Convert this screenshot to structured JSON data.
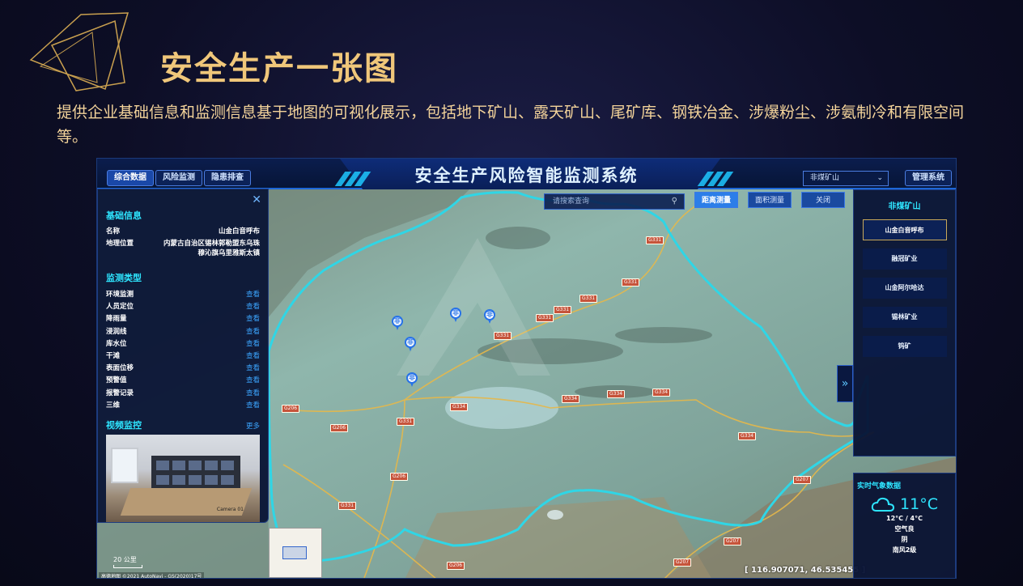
{
  "slide": {
    "title": "安全生产一张图",
    "description": "提供企业基础信息和监测信息基于地图的可视化展示，包括地下矿山、露天矿山、尾矿库、钢铁冶金、涉爆粉尘、涉氨制冷和有限空间等。"
  },
  "app": {
    "title": "安全生产风险智能监测系统",
    "nav": [
      "综合数据",
      "风险监测",
      "隐患排查"
    ],
    "select_value": "非煤矿山",
    "manage_label": "管理系统"
  },
  "map": {
    "search_placeholder": "请搜索查询",
    "tools": [
      "距离测量",
      "面积测量",
      "关闭"
    ],
    "marker_label": "非",
    "road_labels": [
      "G331",
      "G331",
      "G331",
      "G331",
      "G331",
      "G331",
      "G334",
      "G334",
      "G334",
      "G334",
      "G206",
      "G331",
      "G206",
      "G206",
      "G331",
      "G334",
      "G207",
      "G207",
      "G207",
      "G206",
      "G207",
      "G331"
    ],
    "coordinates": "[ 116.907071, 46.535455 ]",
    "scale_label": "20 公里",
    "copyright": "高德地图 ©2021 AutoNavi - GS(2020)17号"
  },
  "info": {
    "basic_title": "基础信息",
    "name_key": "名称",
    "name_value": "山金白音呼布",
    "location_key": "地理位置",
    "location_value": "内蒙古自治区锡林郭勒盟东乌珠穆沁旗乌里雅斯太镇",
    "monitor_title": "监测类型",
    "monitor_items": [
      "环境监测",
      "人员定位",
      "降雨量",
      "浸润线",
      "库水位",
      "干滩",
      "表面位移",
      "预警值",
      "报警记录",
      "三维"
    ],
    "view_label": "查看",
    "video_title": "视频监控",
    "more_label": "更多",
    "video_caption": "Camera 01"
  },
  "mines": {
    "title": "非煤矿山",
    "items": [
      "山金白音呼布",
      "融冠矿业",
      "山金阿尔哈达",
      "锡林矿业",
      "钨矿"
    ]
  },
  "weather": {
    "title": "实时气象数据",
    "temp": "11°C",
    "range": "12°C / 4°C",
    "air": "空气良",
    "sky": "阴",
    "wind": "南风2级"
  },
  "colors": {
    "title_gold": "#f0c77a",
    "accent_cyan": "#2ee5ff",
    "link_blue": "#3ba5ff",
    "boundary": "#2fd6e6"
  }
}
